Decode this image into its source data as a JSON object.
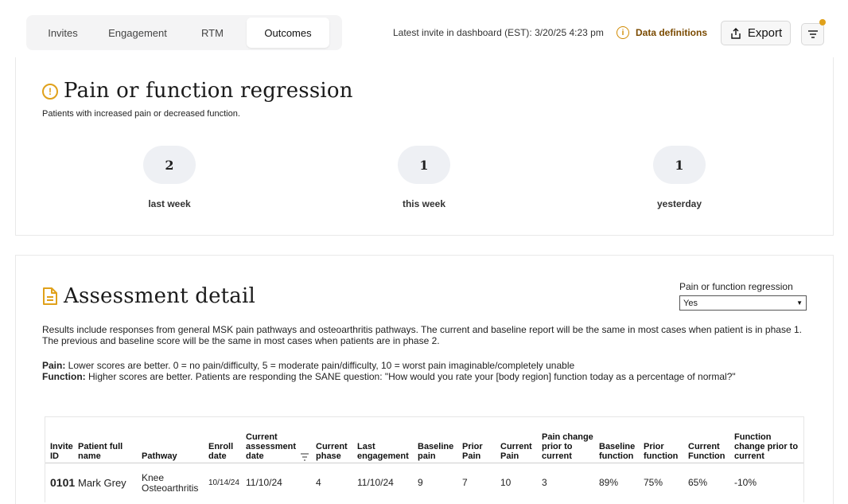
{
  "tabs": [
    {
      "label": "Invites",
      "active": false
    },
    {
      "label": "Engagement",
      "active": false
    },
    {
      "label": "RTM",
      "active": false
    },
    {
      "label": "Outcomes",
      "active": true
    }
  ],
  "header": {
    "latest_invite": "Latest invite in dashboard (EST): 3/20/25 4:23 pm",
    "data_definitions": "Data definitions",
    "export_label": "Export",
    "filter_indicator_color": "#e0a11b"
  },
  "regression": {
    "title": "Pain or function regression",
    "subtitle": "Patients with increased pain or decreased function.",
    "stats": [
      {
        "value": "2",
        "label": "last week"
      },
      {
        "value": "1",
        "label": "this week"
      },
      {
        "value": "1",
        "label": "yesterday"
      }
    ]
  },
  "assessment": {
    "title": "Assessment detail",
    "filter_label": "Pain or function regression",
    "filter_value": "Yes",
    "description": "Results include responses from general MSK pain pathways and osteoarthritis pathways. The current and baseline report will be the same in most cases when patient is in phase 1. The previous and baseline score will be the same in most cases when patients are in phase 2.",
    "pain_label": "Pain:",
    "pain_text": " Lower scores are better. 0 = no pain/difficulty, 5 = moderate pain/difficulty, 10 = worst pain imaginable/completely unable",
    "function_label": "Function:",
    "function_text": " Higher scores are better. Patients are responding the SANE question: \"How would you rate your [body region] function today as a percentage of normal?\""
  },
  "table": {
    "columns": [
      "Invite ID",
      "Patient full name",
      "Pathway",
      "Enroll date",
      "Current assessment date",
      "Current phase",
      "Last engagement",
      "Baseline pain",
      "Prior Pain",
      "Current Pain",
      "Pain change prior to current",
      "Baseline function",
      "Prior function",
      "Current Function",
      "Function change prior to current"
    ],
    "rows": [
      {
        "invite_id": "0101",
        "name": "Mark Grey",
        "pathway": "Knee Osteoarthritis",
        "enroll_date": "10/14/24",
        "assessment_date": "11/10/24",
        "phase": "4",
        "last_engagement": "11/10/24",
        "baseline_pain": "9",
        "prior_pain": "7",
        "current_pain": "10",
        "pain_change": "3",
        "baseline_function": "89%",
        "prior_function": "75%",
        "current_function": "65%",
        "function_change": "-10%"
      }
    ]
  },
  "icons": {
    "info": "info-circle-icon",
    "export": "share-upload-icon",
    "filter": "filter-lines-icon",
    "warning": "exclamation-circle-icon",
    "document": "document-icon",
    "sort": "sort-icon"
  }
}
